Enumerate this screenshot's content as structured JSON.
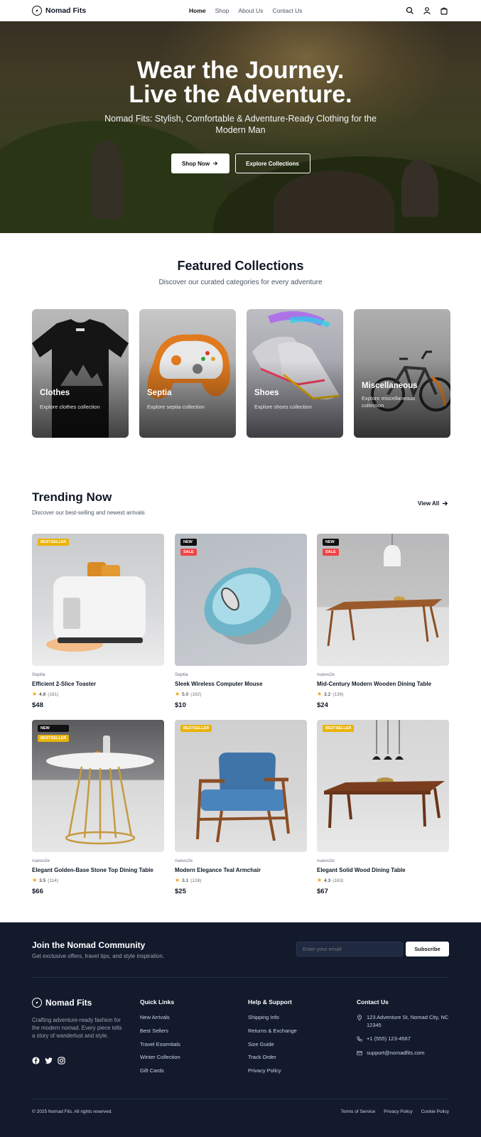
{
  "nav": {
    "brand": "Nomad Fits",
    "links": [
      "Home",
      "Shop",
      "About Us",
      "Contact Us"
    ],
    "icons": [
      "search-icon",
      "user-icon",
      "cart-icon"
    ]
  },
  "hero": {
    "title_line1": "Wear the Journey.",
    "title_line2": "Live the Adventure.",
    "subtitle": "Nomad Fits: Stylish, Comfortable & Adventure-Ready Clothing for the Modern Man",
    "primary_button": "Shop Now",
    "secondary_button": "Explore Collections"
  },
  "featured": {
    "title": "Featured Collections",
    "subtitle": "Discover our curated categories for every adventure",
    "cards": [
      {
        "title": "Clothes",
        "subtitle": "Explore clothes collection"
      },
      {
        "title": "Septia",
        "subtitle": "Explore septia collection"
      },
      {
        "title": "Shoes",
        "subtitle": "Explore shoes collection"
      },
      {
        "title": "Miscellaneous",
        "subtitle": "Explore miscellaneous collection"
      }
    ]
  },
  "trending": {
    "title": "Trending Now",
    "subtitle": "Discover our best-selling and newest arrivals",
    "view_all": "View All",
    "products": [
      {
        "brand": "Septia",
        "name": "Efficient 2-Slice Toaster",
        "rating": "4.8",
        "reviews": "(161)",
        "price": "$48",
        "badges": [
          "BESTSELLER"
        ]
      },
      {
        "brand": "Septia",
        "name": "Sleek Wireless Computer Mouse",
        "rating": "5.0",
        "reviews": "(192)",
        "price": "$10",
        "badges": [
          "NEW",
          "SALE"
        ]
      },
      {
        "brand": "nuevo2e",
        "name": "Mid-Century Modern Wooden Dining Table",
        "rating": "3.2",
        "reviews": "(139)",
        "price": "$24",
        "badges": [
          "NEW",
          "SALE"
        ]
      },
      {
        "brand": "nuevo2e",
        "name": "Elegant Golden-Base Stone Top Dining Table",
        "rating": "3.5",
        "reviews": "(114)",
        "price": "$66",
        "badges": [
          "NEW",
          "BESTSELLER"
        ]
      },
      {
        "brand": "nuevo2e",
        "name": "Modern Elegance Teal Armchair",
        "rating": "3.1",
        "reviews": "(128)",
        "price": "$25",
        "badges": [
          "BESTSELLER"
        ]
      },
      {
        "brand": "nuevo2e",
        "name": "Elegant Solid Wood Dining Table",
        "rating": "4.3",
        "reviews": "(163)",
        "price": "$67",
        "badges": [
          "BESTSELLER"
        ]
      }
    ]
  },
  "newsletter": {
    "title": "Join the Nomad Community",
    "subtitle": "Get exclusive offers, travel tips, and style inspiration.",
    "placeholder": "Enter your email",
    "button": "Subscribe"
  },
  "footer": {
    "brand": "Nomad Fits",
    "description": "Crafting adventure-ready fashion for the modern nomad. Every piece tells a story of wanderlust and style.",
    "social": [
      "facebook-icon",
      "twitter-icon",
      "instagram-icon"
    ],
    "quick_links": {
      "title": "Quick Links",
      "items": [
        "New Arrivals",
        "Best Sellers",
        "Travel Essentials",
        "Winter Collection",
        "Gift Cards"
      ]
    },
    "help": {
      "title": "Help & Support",
      "items": [
        "Shipping Info",
        "Returns & Exchange",
        "Size Guide",
        "Track Order",
        "Privacy Policy"
      ]
    },
    "contact": {
      "title": "Contact Us",
      "address": "123 Adventure St, Nomad City, NC 12345",
      "phone": "+1 (555) 123-4567",
      "email": "support@nomadfits.com"
    },
    "copyright": "© 2025 Nomad Fits. All rights reserved.",
    "legal": [
      "Terms of Service",
      "Privacy Policy",
      "Cookie Policy"
    ]
  },
  "colors": {
    "dark_bg": "#121a2c",
    "bestseller": "#eab308",
    "sale": "#ef4444",
    "new": "#111111",
    "star": "#f59e0b"
  }
}
